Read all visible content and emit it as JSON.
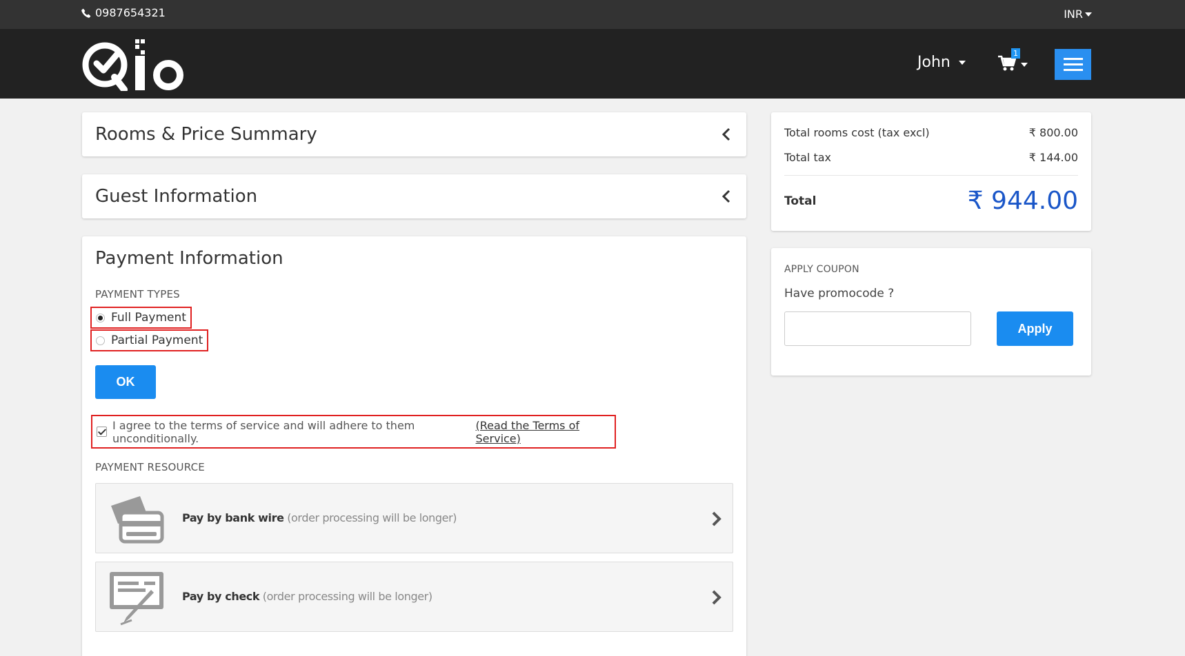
{
  "topbar": {
    "phone": "0987654321",
    "currency": "INR"
  },
  "header": {
    "user_name": "John",
    "cart_count": "1"
  },
  "sections": {
    "rooms_title": "Rooms & Price Summary",
    "guest_title": "Guest Information"
  },
  "payment": {
    "title": "Payment Information",
    "types_label": "PAYMENT TYPES",
    "options": [
      {
        "label": "Full Payment",
        "selected": true
      },
      {
        "label": "Partial Payment",
        "selected": false
      }
    ],
    "ok_label": "OK",
    "terms_text": "I agree to the terms of service and will adhere to them unconditionally.",
    "terms_link": "(Read the Terms of Service)",
    "terms_checked": true,
    "resource_label": "PAYMENT RESOURCE",
    "resources": [
      {
        "name": "Pay by bank wire",
        "note": "(order processing will be longer)"
      },
      {
        "name": "Pay by check",
        "note": "(order processing will be longer)"
      }
    ]
  },
  "summary": {
    "rooms_cost_label": "Total rooms cost (tax excl)",
    "rooms_cost_value": "₹ 800.00",
    "tax_label": "Total tax",
    "tax_value": "₹ 144.00",
    "total_label": "Total",
    "total_value": "₹ 944.00"
  },
  "coupon": {
    "label": "APPLY COUPON",
    "prompt": "Have promocode ?",
    "input_value": "",
    "apply_label": "Apply"
  },
  "colors": {
    "topbar": "#333333",
    "header": "#222222",
    "accent": "#1a8cf0",
    "total": "#1a56c8",
    "highlight": "#e02020"
  }
}
